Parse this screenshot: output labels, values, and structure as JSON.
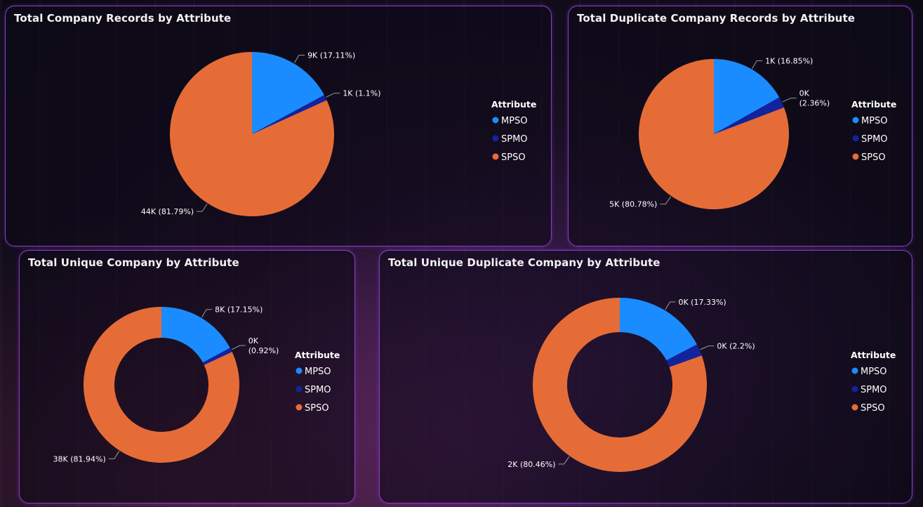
{
  "colors": {
    "MPSO": "#1a8cff",
    "SPMO": "#12239e",
    "SPSO": "#e66c37"
  },
  "legend": {
    "title": "Attribute",
    "items": [
      "MPSO",
      "SPMO",
      "SPSO"
    ]
  },
  "chart_data": [
    {
      "type": "pie",
      "title": "Total Company Records by Attribute",
      "categories": [
        "MPSO",
        "SPMO",
        "SPSO"
      ],
      "percents": [
        17.11,
        1.1,
        81.79
      ],
      "labels": [
        "9K (17.11%)",
        "1K (1.1%)",
        "44K (81.79%)"
      ],
      "donut": false
    },
    {
      "type": "pie",
      "title": "Total Duplicate Company Records by Attribute",
      "categories": [
        "MPSO",
        "SPMO",
        "SPSO"
      ],
      "percents": [
        16.85,
        2.36,
        80.78
      ],
      "labels": [
        "1K (16.85%)",
        "0K\n(2.36%)",
        "5K (80.78%)"
      ],
      "donut": false
    },
    {
      "type": "pie",
      "title": "Total Unique Company by Attribute",
      "categories": [
        "MPSO",
        "SPMO",
        "SPSO"
      ],
      "percents": [
        17.15,
        0.92,
        81.94
      ],
      "labels": [
        "8K (17.15%)",
        "0K\n(0.92%)",
        "38K (81.94%)"
      ],
      "donut": true
    },
    {
      "type": "pie",
      "title": "Total Unique Duplicate Company by Attribute",
      "categories": [
        "MPSO",
        "SPMO",
        "SPSO"
      ],
      "percents": [
        17.33,
        2.2,
        80.46
      ],
      "labels": [
        "0K (17.33%)",
        "0K (2.2%)",
        "2K (80.46%)"
      ],
      "donut": true
    }
  ]
}
